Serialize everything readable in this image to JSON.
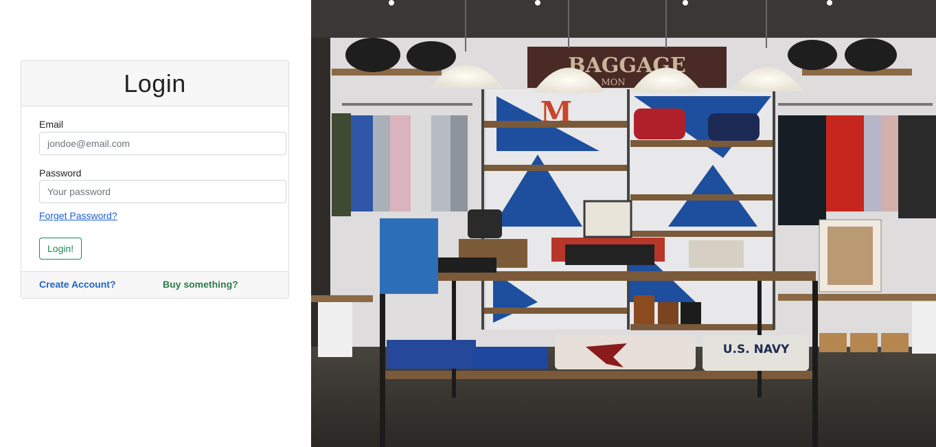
{
  "login": {
    "title": "Login",
    "email_label": "Email",
    "email_placeholder": "jondoe@email.com",
    "password_label": "Password",
    "password_placeholder": "Your password",
    "forgot_link": "Forget Password?",
    "submit_label": "Login!",
    "create_account": "Create Account?",
    "buy_something": "Buy something?"
  },
  "photo": {
    "sign_text": "BAGGAGE",
    "sign_sub": "MON",
    "letter": "M",
    "folded_shirt_text": "U.S. NAVY"
  },
  "colors": {
    "link_blue": "#1a5fd0",
    "success_green": "#198754",
    "brand_blue": "#1d4f9e"
  }
}
